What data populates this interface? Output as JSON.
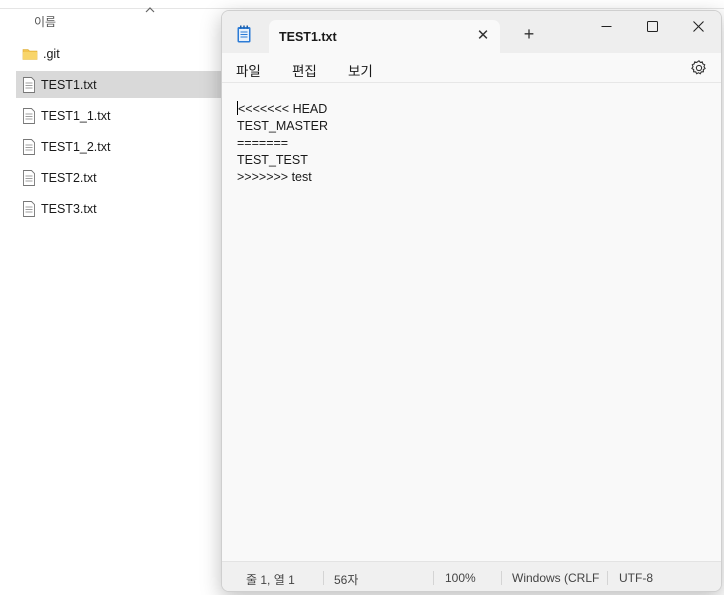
{
  "explorer": {
    "column_header": "이름",
    "files": [
      {
        "name": ".git",
        "type": "folder",
        "selected": false
      },
      {
        "name": "TEST1.txt",
        "type": "text",
        "selected": true
      },
      {
        "name": "TEST1_1.txt",
        "type": "text",
        "selected": false
      },
      {
        "name": "TEST1_2.txt",
        "type": "text",
        "selected": false
      },
      {
        "name": "TEST2.txt",
        "type": "text",
        "selected": false
      },
      {
        "name": "TEST3.txt",
        "type": "text",
        "selected": false
      }
    ]
  },
  "notepad": {
    "tab_title": "TEST1.txt",
    "tab_close": "✕",
    "new_tab": "+",
    "menu": {
      "file": "파일",
      "edit": "편집",
      "view": "보기"
    },
    "content_lines": [
      "<<<<<<< HEAD",
      "TEST_MASTER",
      "=======",
      "TEST_TEST",
      ">>>>>>> test"
    ],
    "status": {
      "position": "줄 1, 열 1",
      "char_count": "56자",
      "zoom": "100%",
      "line_ending": "Windows (CRLF)",
      "encoding": "UTF-8"
    }
  },
  "colors": {
    "selection": "#d9d9d9",
    "titlebar": "#eeeeee",
    "editor_bg": "#f9f9f9",
    "notepad_icon": "#2b7bd6"
  }
}
